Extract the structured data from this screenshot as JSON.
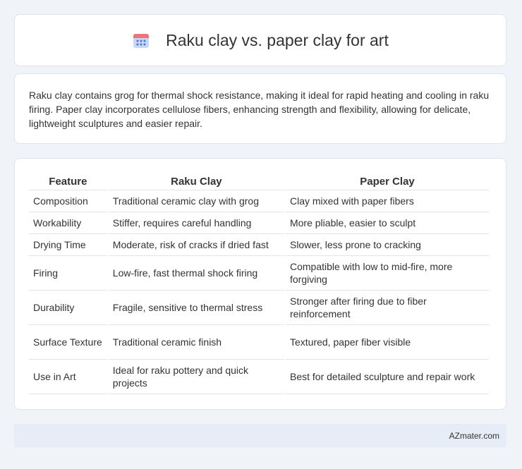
{
  "header": {
    "title": "Raku clay vs. paper clay for art",
    "icon": "calendar-icon",
    "icon_colors": {
      "top": "#e87878",
      "body": "#8fb0e8",
      "dots": "#5a7fd0"
    }
  },
  "intro": {
    "text": "Raku clay contains grog for thermal shock resistance, making it ideal for rapid heating and cooling in raku firing. Paper clay incorporates cellulose fibers, enhancing strength and flexibility, allowing for delicate, lightweight sculptures and easier repair."
  },
  "table": {
    "headers": [
      "Feature",
      "Raku Clay",
      "Paper Clay"
    ],
    "rows": [
      [
        "Composition",
        "Traditional ceramic clay with grog",
        "Clay mixed with paper fibers"
      ],
      [
        "Workability",
        "Stiffer, requires careful handling",
        "More pliable, easier to sculpt"
      ],
      [
        "Drying Time",
        "Moderate, risk of cracks if dried fast",
        "Slower, less prone to cracking"
      ],
      [
        "Firing",
        "Low-fire, fast thermal shock firing",
        "Compatible with low to mid-fire, more forgiving"
      ],
      [
        "Durability",
        "Fragile, sensitive to thermal stress",
        "Stronger after firing due to fiber reinforcement"
      ],
      [
        "Surface Texture",
        "Traditional ceramic finish",
        "Textured, paper fiber visible"
      ],
      [
        "Use in Art",
        "Ideal for raku pottery and quick projects",
        "Best for detailed sculpture and repair work"
      ]
    ]
  },
  "footer": {
    "text": "AZmater.com"
  }
}
